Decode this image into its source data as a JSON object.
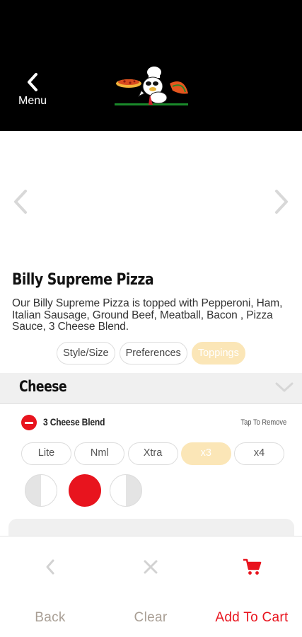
{
  "header": {
    "back_label": "Menu",
    "logo_name": "chef-pizza-logo"
  },
  "item": {
    "title": "Billy Supreme Pizza",
    "description": "Our Billy Supreme Pizza is topped with Pepperoni, Ham, Italian Sausage, Ground Beef, Meatball, Bacon , Pizza Sauce, 3 Cheese Blend."
  },
  "tabs": [
    {
      "label": "Style/Size",
      "active": false
    },
    {
      "label": "Preferences",
      "active": false
    },
    {
      "label": "Toppings",
      "active": true
    }
  ],
  "section": {
    "title": "Cheese"
  },
  "topping": {
    "name": "3 Cheese Blend",
    "remove_hint": "Tap To Remove",
    "amounts": [
      {
        "label": "Lite",
        "active": false
      },
      {
        "label": "Nml",
        "active": false
      },
      {
        "label": "Xtra",
        "active": false
      },
      {
        "label": "x3",
        "active": true
      },
      {
        "label": "x4",
        "active": false
      }
    ],
    "portion_selected": "whole"
  },
  "bottom": {
    "back_label": "Back",
    "clear_label": "Clear",
    "cart_label": "Add To Cart"
  },
  "colors": {
    "accent_red": "#e8141e",
    "active_pill": "#fbe6b7",
    "muted_label": "#a99f95",
    "header_bg": "#000000"
  }
}
